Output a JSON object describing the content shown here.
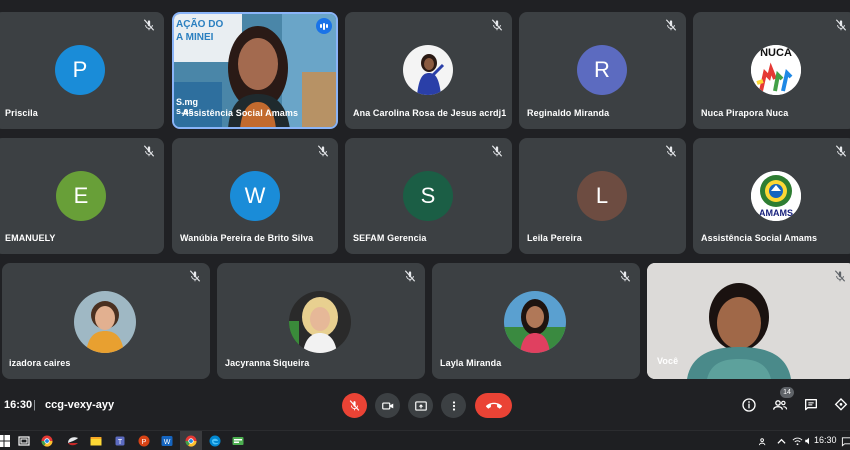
{
  "participants": [
    {
      "name": "Priscila",
      "initial": "P",
      "color": "#1a8cd8"
    },
    {
      "name": "Assistência Social Amams",
      "video_sign": [
        "AÇÃO DO",
        "A MINEI"
      ],
      "video_sign2": [
        "S.mg",
        "s.as"
      ]
    },
    {
      "name": "Ana Carolina Rosa de Jesus acrdj1"
    },
    {
      "name": "Reginaldo Miranda",
      "initial": "R",
      "color": "#5c6bc0"
    },
    {
      "name": "Nuca Pirapora Nuca",
      "logo_text": "NUCA"
    },
    {
      "name": "EMANUELY",
      "initial": "E",
      "color": "#689f38"
    },
    {
      "name": "Wanúbia Pereira de Brito Silva",
      "initial": "W",
      "color": "#1a8cd8"
    },
    {
      "name": "SEFAM Gerencia",
      "initial": "S",
      "color": "#1b5e45"
    },
    {
      "name": "Leila Pereira",
      "initial": "L",
      "color": "#6d4c41"
    },
    {
      "name": "Assistência Social Amams",
      "logo_text": "AMAMS"
    },
    {
      "name": "izadora caires"
    },
    {
      "name": "Jacyranna Siqueira"
    },
    {
      "name": "Layla Miranda"
    },
    {
      "name": "Você"
    }
  ],
  "meeting": {
    "time": "16:30",
    "separator": "|",
    "code": "ccg-vexy-ayy",
    "people_count": "14"
  },
  "colors": {
    "tile_bg": "#3c4043",
    "page_bg": "#202124",
    "end_call": "#ea4335",
    "speaking_border": "#8ab4f8",
    "accent": "#1a73e8"
  },
  "icons": {
    "mic_off": "mic-off-icon",
    "camera": "camera-icon",
    "present": "present-screen-icon",
    "more": "more-vert-icon",
    "end_call": "phone-hangup-icon",
    "info": "info-icon",
    "people": "people-icon",
    "chat": "chat-icon",
    "activities": "activities-icon"
  },
  "taskbar": {
    "clock": "16:30"
  }
}
